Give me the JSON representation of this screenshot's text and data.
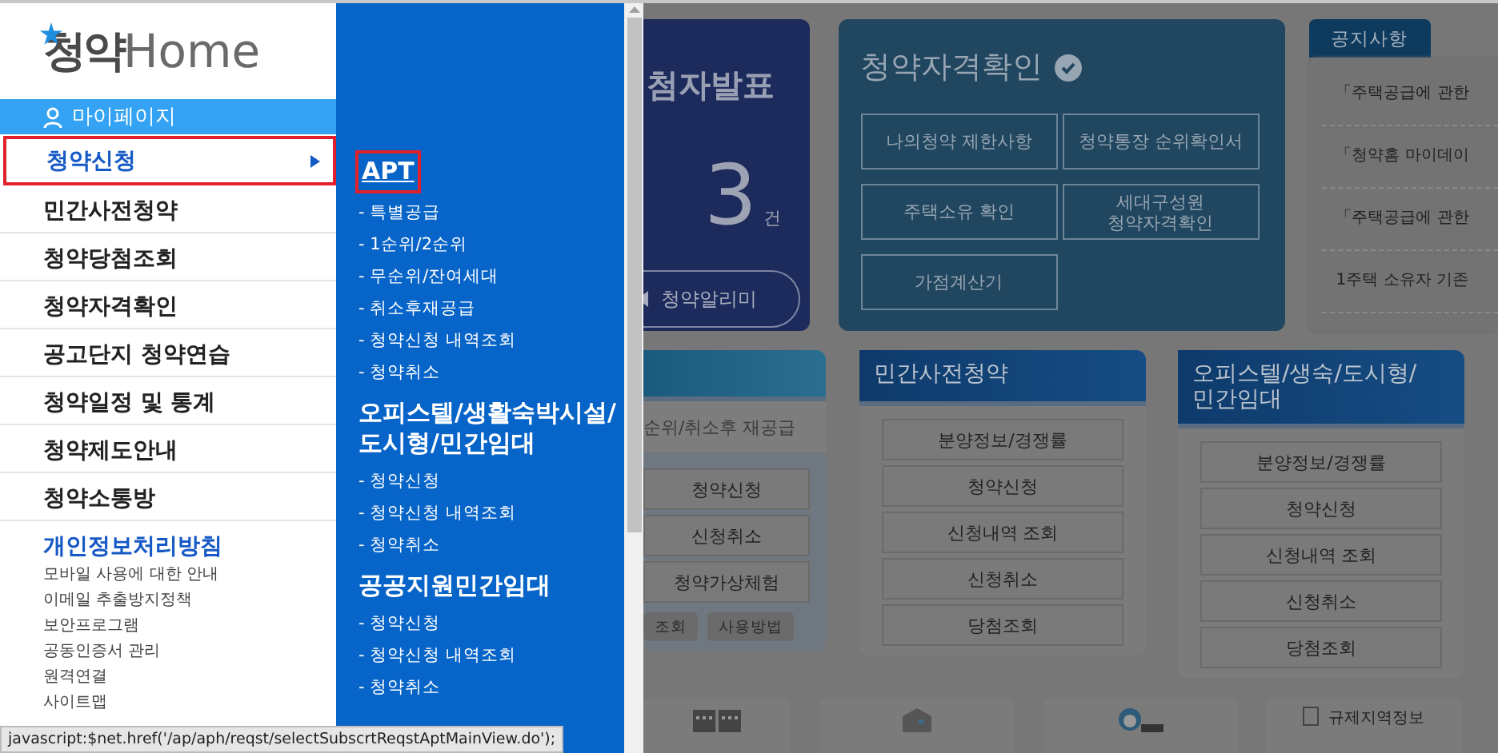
{
  "sidebar": {
    "logo": {
      "korean": "청약",
      "latin": "Home"
    },
    "mypage": "마이페이지",
    "menu": [
      {
        "label": "청약신청",
        "selected": true
      },
      {
        "label": "민간사전청약",
        "selected": false
      },
      {
        "label": "청약당첨조회",
        "selected": false
      },
      {
        "label": "청약자격확인",
        "selected": false
      },
      {
        "label": "공고단지 청약연습",
        "selected": false
      },
      {
        "label": "청약일정 및 통계",
        "selected": false
      },
      {
        "label": "청약제도안내",
        "selected": false
      },
      {
        "label": "청약소통방",
        "selected": false
      }
    ],
    "policy": {
      "title": "개인정보처리방침",
      "links": [
        "모바일 사용에 대한 안내",
        "이메일 추출방지정책",
        "보안프로그램",
        "공동인증서 관리",
        "원격연결",
        "사이트맵"
      ]
    }
  },
  "submenu": {
    "groups": [
      {
        "title": "APT",
        "selected": true,
        "items": [
          "- 특별공급",
          "- 1순위/2순위",
          "- 무순위/잔여세대",
          "- 취소후재공급",
          "- 청약신청 내역조회",
          "- 청약취소"
        ]
      },
      {
        "title": "오피스텔/생활숙박시설/ 도시형/민간임대",
        "selected": false,
        "items": [
          "- 청약신청",
          "- 청약신청 내역조회",
          "- 청약취소"
        ]
      },
      {
        "title": "공공지원민간임대",
        "selected": false,
        "items": [
          "- 청약신청",
          "- 청약신청 내역조회",
          "- 청약취소"
        ]
      }
    ]
  },
  "background_page": {
    "winners": {
      "title": "첨자발표",
      "count": "3",
      "unit": "건",
      "button": "청약알리미"
    },
    "eligibility": {
      "title": "청약자격확인",
      "buttons": [
        "나의청약 제한사항",
        "청약통장 순위확인서",
        "주택소유 확인",
        "세대구성원 청약자격확인",
        "가점계산기"
      ]
    },
    "notice": {
      "tab": "공지사항",
      "items": [
        "「주택공급에 관한",
        "「청약홈 마이데이",
        "「주택공급에 관한",
        "1주택 소유자 기존"
      ]
    },
    "apt": {
      "subtitle": "순위/취소후 재공급",
      "buttons": [
        "청약신청",
        "신청취소",
        "청약가상체험"
      ],
      "small_buttons": [
        "조회",
        "사용방법"
      ]
    },
    "presale": {
      "title": "민간사전청약",
      "buttons": [
        "분양정보/경쟁률",
        "청약신청",
        "신청내역 조회",
        "신청취소",
        "당첨조회"
      ]
    },
    "officetel": {
      "title": "오피스텔/생숙/도시형/ 민간임대",
      "buttons": [
        "분양정보/경쟁률",
        "청약신청",
        "신청내역 조회",
        "신청취소",
        "당첨조회"
      ]
    },
    "quick": [
      {
        "kind": "building"
      },
      {
        "kind": "house"
      },
      {
        "kind": "person"
      },
      {
        "kind": "text",
        "label": "규제지역정보"
      }
    ]
  },
  "status_url": "javascript:$net.href('/ap/aph/reqst/selectSubscrtReqstAptMainView.do');"
}
